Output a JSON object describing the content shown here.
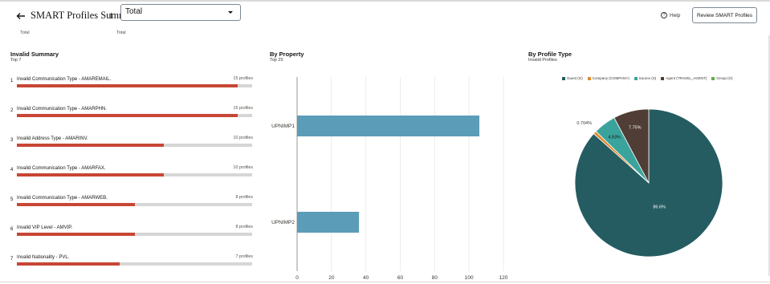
{
  "header": {
    "title": "SMART Profiles Summary",
    "select_value": "Total",
    "sub_left": "Total",
    "sub_right": "Total",
    "help_label": "Help",
    "review_button": "Review SMART Profiles"
  },
  "invalid_summary": {
    "title": "Invalid Summary",
    "subtitle": "Top 7",
    "max": 16,
    "items": [
      {
        "rank": "1",
        "label": "Invalid Communication Type - AMAREMAIL.",
        "count_label": "15 profiles",
        "count": 15
      },
      {
        "rank": "2",
        "label": "Invalid Communication Type - AMARPHN.",
        "count_label": "15 profiles",
        "count": 15
      },
      {
        "rank": "3",
        "label": "Invalid Address Type - AMARINV.",
        "count_label": "10 profiles",
        "count": 10
      },
      {
        "rank": "4",
        "label": "Invalid Communication Type - AMARFAX.",
        "count_label": "10 profiles",
        "count": 10
      },
      {
        "rank": "5",
        "label": "Invalid Communication Type - AMARWEB.",
        "count_label": "8 profiles",
        "count": 8
      },
      {
        "rank": "6",
        "label": "Invalid VIP Level - AMVIP.",
        "count_label": "8 profiles",
        "count": 8
      },
      {
        "rank": "7",
        "label": "Invalid Nationality - PVL.",
        "count_label": "7 profiles",
        "count": 7
      }
    ]
  },
  "by_property": {
    "title": "By Property",
    "subtitle": "Top 25"
  },
  "by_profile_type": {
    "title": "By Profile Type",
    "subtitle": "Invalid Profiles"
  },
  "colors": {
    "accent_red": "#c74634",
    "bar_blue": "#5b9cb8",
    "guest": "#245c61",
    "company": "#e08a2c",
    "source": "#3aa39c",
    "agent": "#4f3d36",
    "group": "#6aa84f"
  },
  "chart_data": [
    {
      "type": "bar",
      "orientation": "horizontal",
      "categories": [
        "UPNIMP1",
        "UPNIMP2"
      ],
      "values": [
        106,
        36
      ],
      "xlim": [
        0,
        120
      ],
      "xticks": [
        "0",
        "20",
        "40",
        "60",
        "80",
        "100",
        "120"
      ],
      "grid": true
    },
    {
      "type": "pie",
      "legend_position": "top",
      "series": [
        {
          "name": "Guest (G)",
          "value": 86.6,
          "label": "86.6%"
        },
        {
          "name": "Company (COMPANY)",
          "value": 0.704,
          "label": "0.704%"
        },
        {
          "name": "Source (S)",
          "value": 4.93,
          "label": "4.93%"
        },
        {
          "name": "Agent (TRAVEL_AGENT)",
          "value": 7.75,
          "label": "7.75%"
        },
        {
          "name": "Group (G)",
          "value": 0,
          "label": ""
        }
      ]
    }
  ]
}
